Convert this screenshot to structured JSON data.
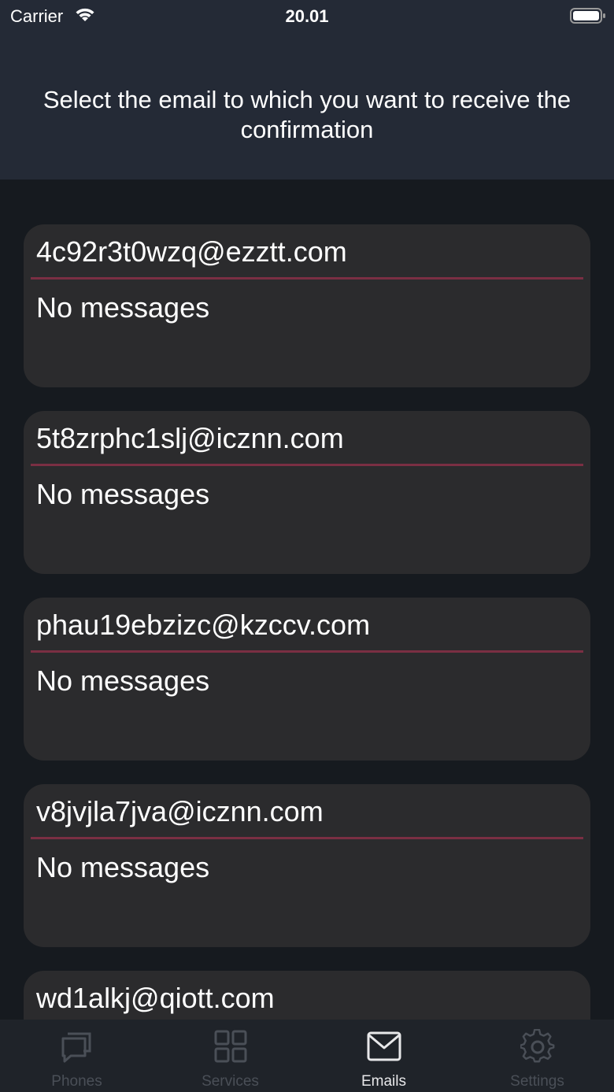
{
  "status_bar": {
    "carrier": "Carrier",
    "time": "20.01"
  },
  "header": {
    "title": "Select the email to which you want to receive the confirmation"
  },
  "emails": [
    {
      "address": "4c92r3t0wzq@ezztt.com",
      "status": "No messages"
    },
    {
      "address": "5t8zrphc1slj@icznn.com",
      "status": "No messages"
    },
    {
      "address": "phau19ebzizc@kzccv.com",
      "status": "No messages"
    },
    {
      "address": "v8jvjla7jva@icznn.com",
      "status": "No messages"
    },
    {
      "address": "wd1alkj@qiott.com",
      "status": ""
    }
  ],
  "tabs": [
    {
      "label": "Phones",
      "icon": "chat-bubbles-icon",
      "active": false
    },
    {
      "label": "Services",
      "icon": "grid-icon",
      "active": false
    },
    {
      "label": "Emails",
      "icon": "envelope-icon",
      "active": true
    },
    {
      "label": "Settings",
      "icon": "gear-icon",
      "active": false
    }
  ],
  "colors": {
    "header_bg": "#242a36",
    "page_bg": "#161a1f",
    "card_bg": "#2b2b2d",
    "divider": "#7a2f43",
    "tab_inactive": "#4a4f57",
    "tab_active": "#e8e8ea"
  }
}
